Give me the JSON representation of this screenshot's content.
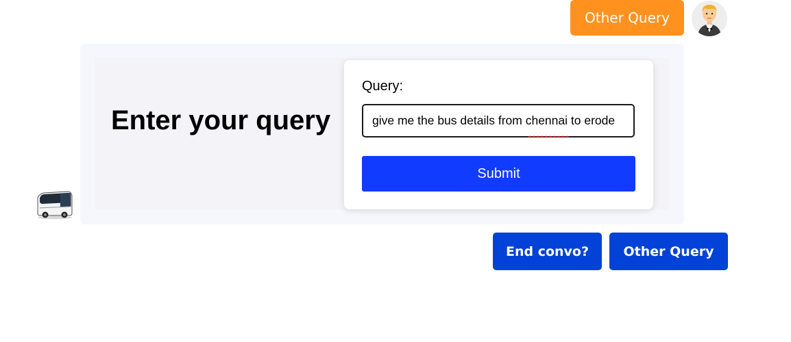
{
  "user_message": {
    "label": "Other Query",
    "color": "#ff921f",
    "avatar_icon": "man-in-tuxedo-icon"
  },
  "bot_message": {
    "avatar_icon": "bus-icon",
    "heading": "Enter your query",
    "form": {
      "label": "Query:",
      "input_value": "give me the bus details from chennai to erode",
      "submit_label": "Submit",
      "submit_color": "#113bff"
    }
  },
  "actions": {
    "end_label": "End convo?",
    "other_label": "Other Query",
    "color": "#0342d6"
  }
}
